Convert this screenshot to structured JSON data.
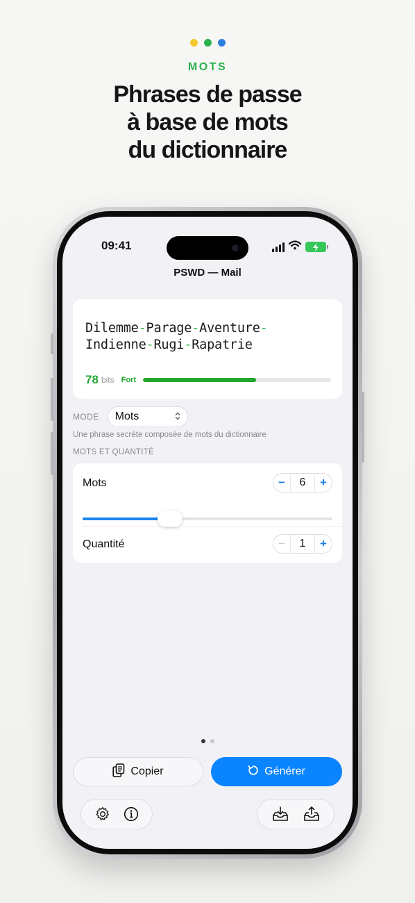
{
  "header": {
    "dot_colors": [
      "#f2c92c",
      "#2bb24c",
      "#2f7fe0"
    ],
    "kicker": "MOTS",
    "kicker_color": "#2bb24c",
    "headline_lines": [
      "Phrases de passe",
      "à base de mots",
      "du dictionnaire"
    ]
  },
  "status_bar": {
    "time": "09:41",
    "icons": [
      "signal-icon",
      "wifi-icon",
      "battery-charging-icon"
    ]
  },
  "app": {
    "title": "PSWD — Mail",
    "password": {
      "words": [
        "Dilemme",
        "Parage",
        "Aventure",
        "Indienne",
        "Rugi",
        "Rapatrie"
      ],
      "separator": "-",
      "bits": "78",
      "bits_unit": "bits",
      "strength_label": "Fort",
      "strength_fraction": 0.6,
      "strength_color": "#22a62e"
    },
    "mode": {
      "label": "MODE",
      "value": "Mots",
      "description": "Une phrase secrète composée de mots du dictionnaire"
    },
    "section_label": "MOTS ET QUANTITÉ",
    "words_setting": {
      "label": "Mots",
      "value": "6",
      "minus": "−",
      "plus": "+",
      "slider_fraction": 0.35
    },
    "quantity_setting": {
      "label": "Quantité",
      "value": "1",
      "minus": "−",
      "plus": "+"
    },
    "page_indicator": {
      "count": 2,
      "active": 0
    },
    "actions": {
      "copy_label": "Copier",
      "generate_label": "Générer",
      "accent": "#0a84ff"
    },
    "toolbar_left": [
      "settings-icon",
      "info-icon"
    ],
    "toolbar_right": [
      "import-icon",
      "export-icon"
    ]
  }
}
